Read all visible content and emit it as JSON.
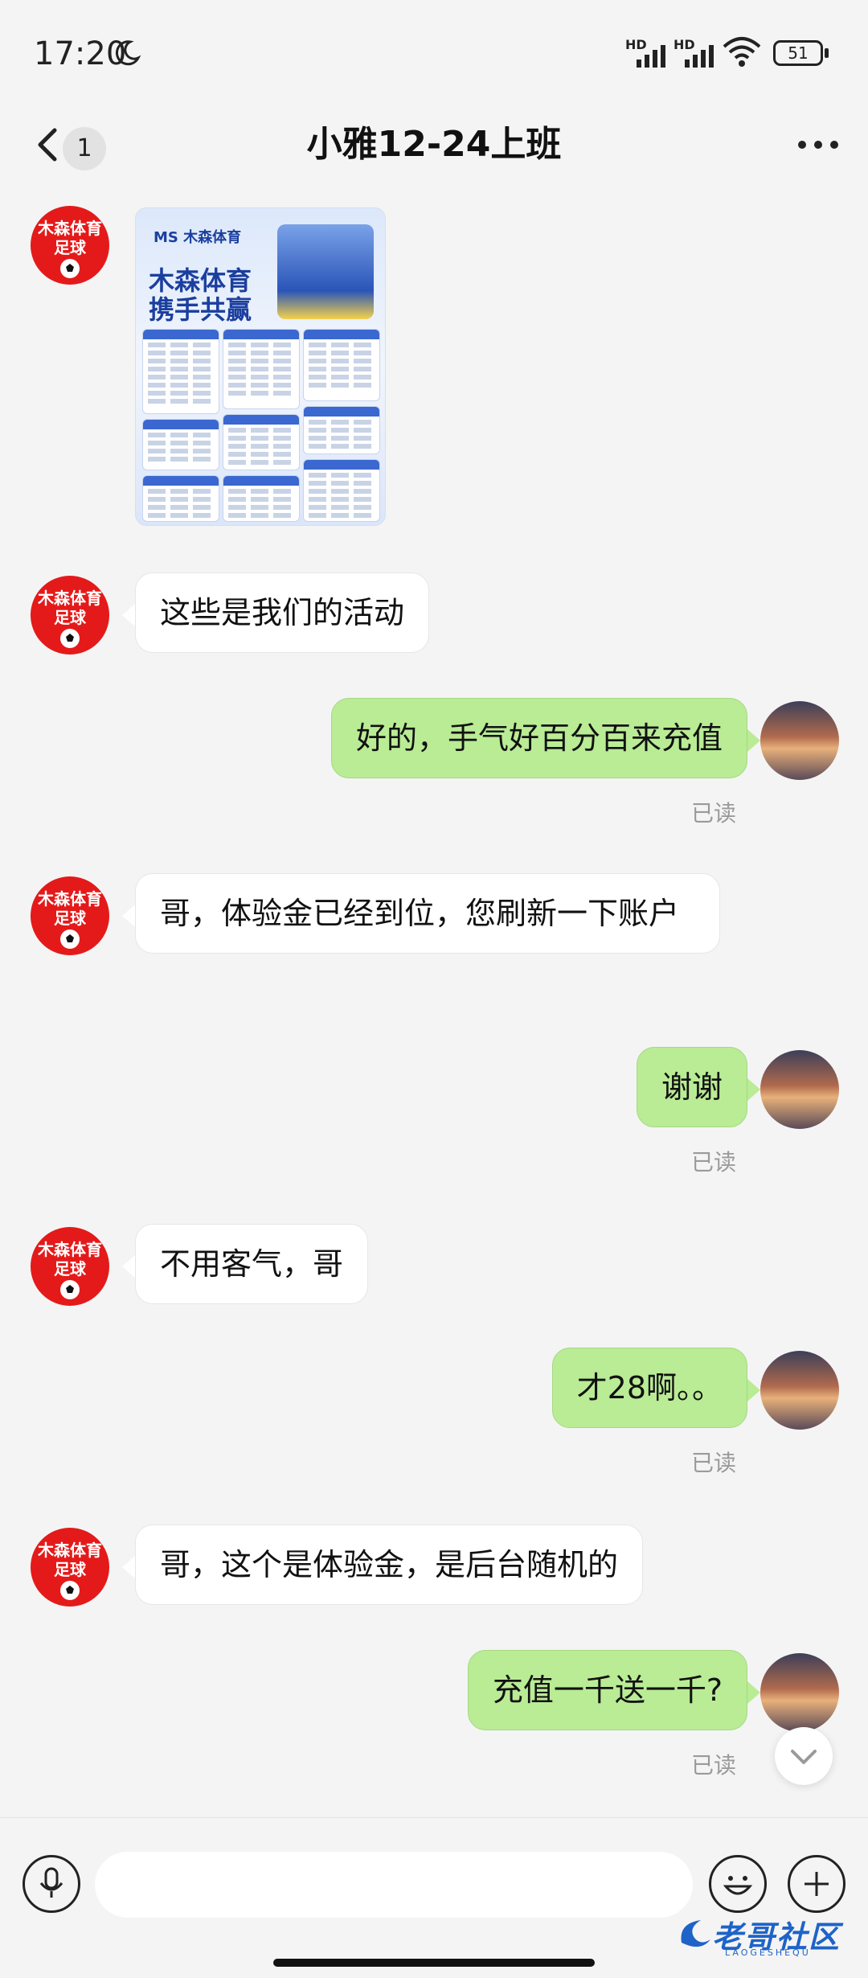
{
  "status_bar": {
    "time": "17:20",
    "network_labels": [
      "HD",
      "HD"
    ],
    "battery": "51",
    "icons": [
      "moon-icon",
      "signal-icon",
      "signal-icon",
      "wifi-icon",
      "battery-icon"
    ]
  },
  "header": {
    "back_icon": "chevron-left-icon",
    "unread_count": "1",
    "title": "小雅12-24上班",
    "more_icon": "more-icon"
  },
  "contact_avatar": {
    "line1": "木森体育",
    "line2": "足球"
  },
  "poster": {
    "logo": "MS 木森体育",
    "title_line1": "木森体育",
    "title_line2": "携手共赢"
  },
  "messages": [
    {
      "side": "left",
      "type": "image"
    },
    {
      "side": "left",
      "type": "text",
      "text": "这些是我们的活动"
    },
    {
      "side": "right",
      "type": "text",
      "text": "好的，手气好百分百来充值",
      "status": "已读"
    },
    {
      "side": "left",
      "type": "text",
      "text": "哥，体验金已经到位，您刷新一下账户"
    },
    {
      "side": "right",
      "type": "text",
      "text": "谢谢",
      "status": "已读"
    },
    {
      "side": "left",
      "type": "text",
      "text": "不用客气，哥"
    },
    {
      "side": "right",
      "type": "text",
      "text": "才28啊。。",
      "status": "已读"
    },
    {
      "side": "left",
      "type": "text",
      "text": "哥，这个是体验金，是后台随机的"
    },
    {
      "side": "right",
      "type": "text",
      "text": "充值一千送一千?",
      "status": "已读"
    }
  ],
  "input_bar": {
    "placeholder": "",
    "icons": [
      "mic-icon",
      "emoji-icon",
      "plus-icon"
    ]
  },
  "watermark": {
    "main": "老哥社区",
    "sub": "LAOGESHEQU"
  },
  "colors": {
    "sent_bubble": "#b9ec95",
    "received_bubble": "#ffffff",
    "avatar_red": "#e41a1a",
    "background": "#f4f4f4"
  }
}
